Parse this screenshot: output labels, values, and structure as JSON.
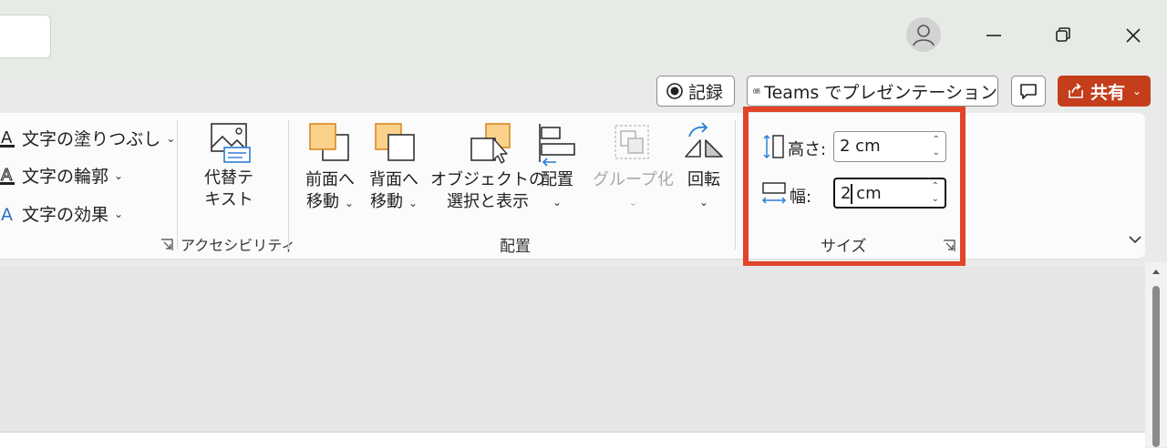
{
  "titlebar": {
    "account": "account-avatar",
    "minimize": "minimize-icon",
    "restore": "restore-icon",
    "close": "close-icon"
  },
  "commandbar": {
    "record_label": "記録",
    "teams_label": "Teams でプレゼンテーション",
    "share_label": "共有"
  },
  "ribbon": {
    "text_group": {
      "fill": "文字の塗りつぶし",
      "outline": "文字の輪郭",
      "effects": "文字の効果"
    },
    "accessibility": {
      "alt_text_line1": "代替テ",
      "alt_text_line2": "キスト",
      "group_label": "アクセシビリティ"
    },
    "arrange": {
      "bring_forward_1": "前面へ",
      "bring_forward_2": "移動",
      "send_backward_1": "背面へ",
      "send_backward_2": "移動",
      "selection_pane_1": "オブジェクトの",
      "selection_pane_2": "選択と表示",
      "align": "配置",
      "group": "グループ化",
      "rotate": "回転",
      "group_label": "配置"
    },
    "size": {
      "height_label": "高さ:",
      "height_value": "2 cm",
      "width_label": "幅:",
      "width_value": "2 cm",
      "group_label": "サイズ"
    }
  },
  "colors": {
    "share_button": "#c43e1c",
    "highlight_box": "#e0452b",
    "shape_fill": "#fbd28c"
  }
}
